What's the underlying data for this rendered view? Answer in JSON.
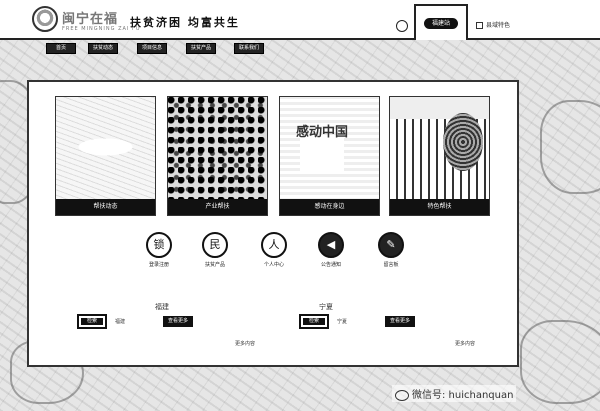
{
  "header": {
    "brand_name": "闽宁在福",
    "brand_sub": "FREE MINGNING ZAI FU",
    "slogan": "扶贫济困  均富共生",
    "active_tab_label": "福建站",
    "right_link": "县域特色"
  },
  "nav": {
    "items": [
      "首页",
      "扶贫动态",
      "项目信息",
      "扶贫产品",
      "联系我们"
    ]
  },
  "cards": [
    {
      "caption": "帮扶动态"
    },
    {
      "caption": "产业帮扶"
    },
    {
      "caption": "感动在身边"
    },
    {
      "caption": "特色帮扶"
    }
  ],
  "sign_text": "感动中国",
  "icons": [
    {
      "name": "lock-icon",
      "glyph": "锁",
      "label": "登录注册"
    },
    {
      "name": "badge-icon",
      "glyph": "民",
      "label": "扶贫产品"
    },
    {
      "name": "user-icon",
      "glyph": "人",
      "label": "个人中心"
    },
    {
      "name": "speaker-icon",
      "glyph": "◀",
      "label": "公告通知"
    },
    {
      "name": "chat-icon",
      "glyph": "✎",
      "label": "留言板"
    }
  ],
  "sections": {
    "left": {
      "title": "福建",
      "btn1": "检索",
      "text": "福建",
      "btn2": "查看更多",
      "more": "更多内容"
    },
    "right": {
      "title": "宁夏",
      "btn1": "检索",
      "text": "宁夏",
      "btn2": "查看更多",
      "more": "更多内容"
    }
  },
  "watermark": "微信号: huichanquan"
}
